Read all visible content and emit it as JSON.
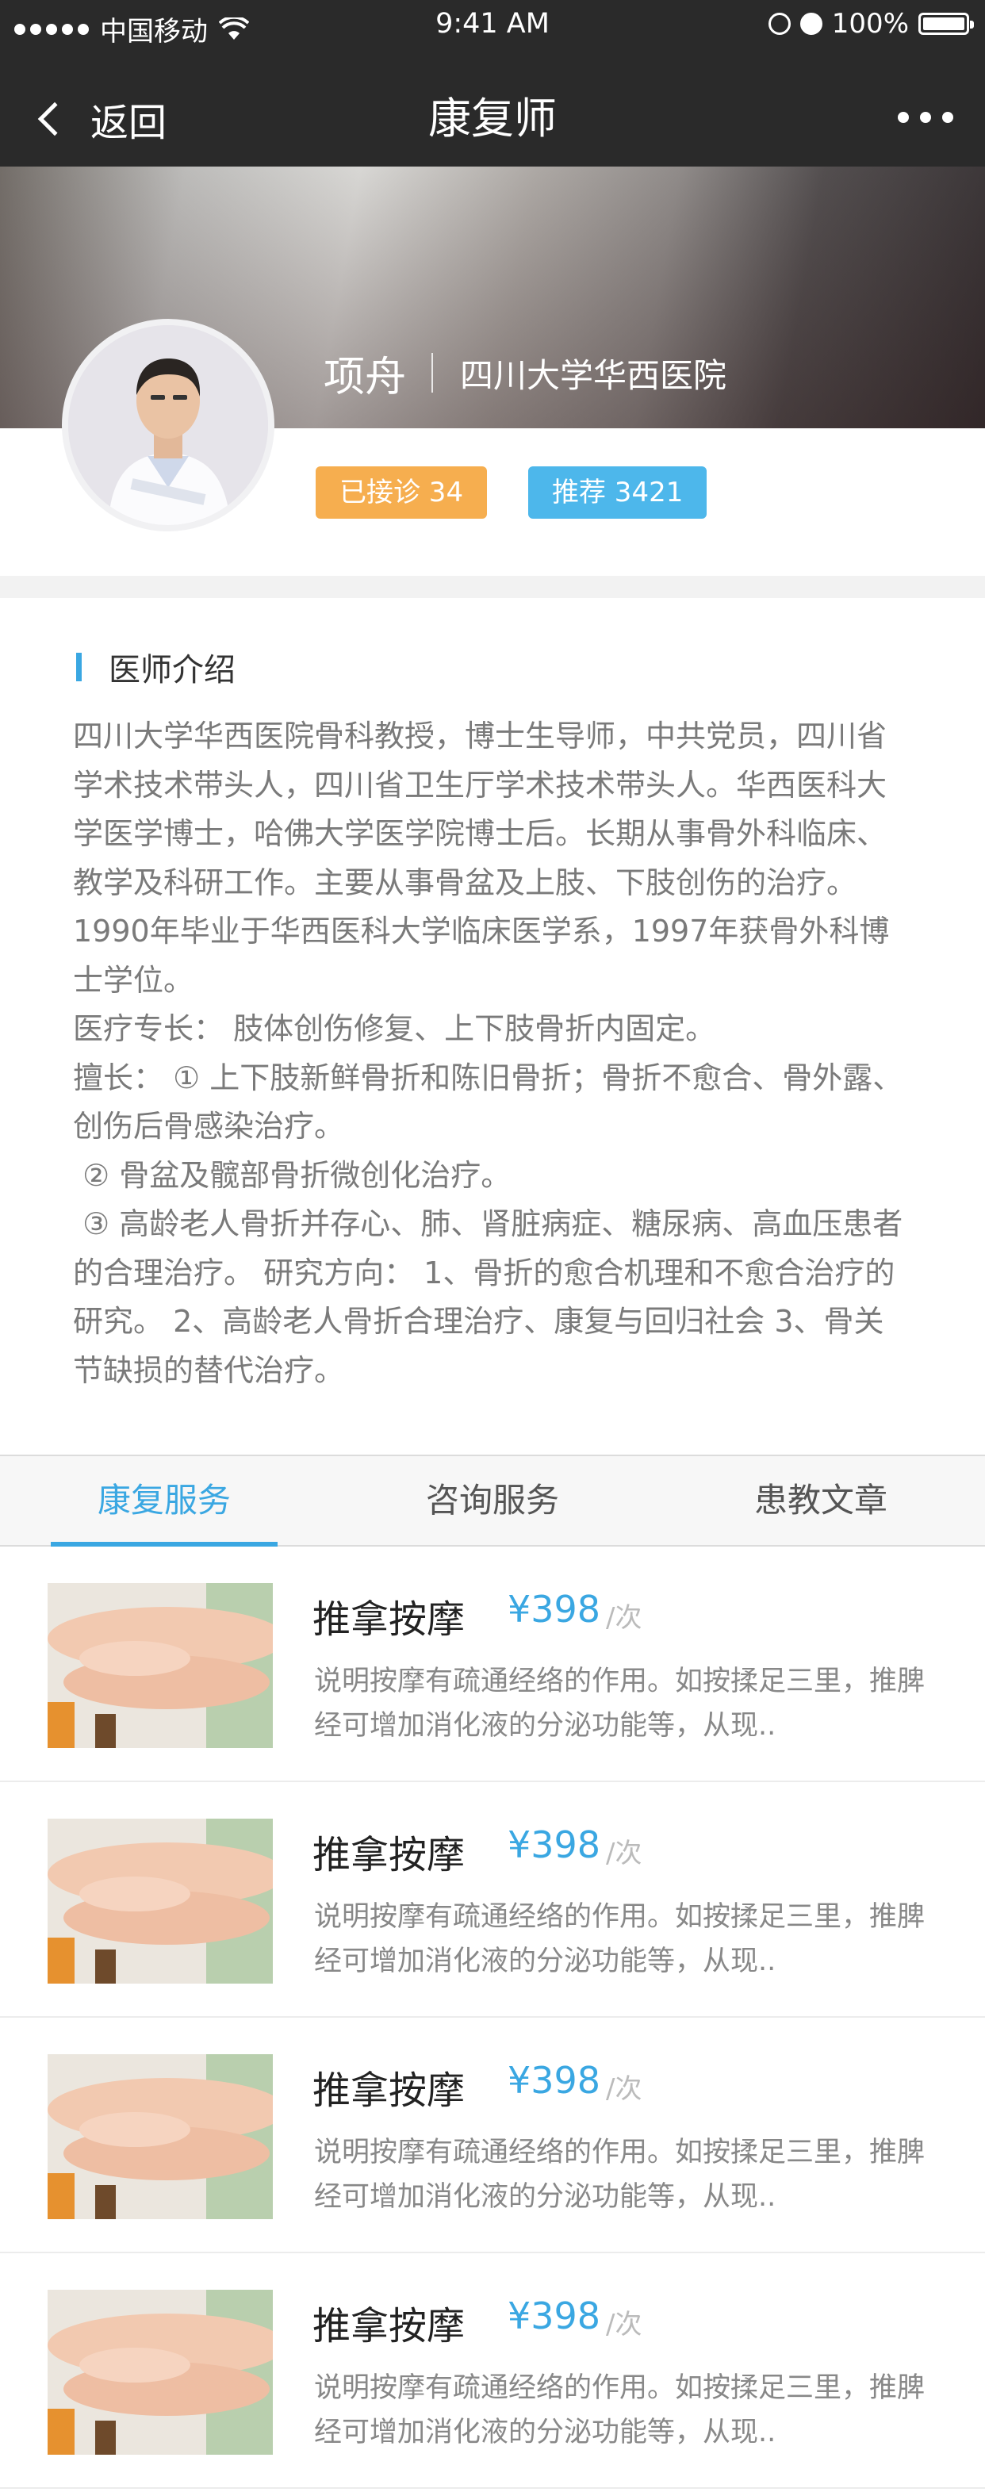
{
  "status_bar": {
    "carrier": "中国移动",
    "time": "9:41 AM",
    "battery": "100%"
  },
  "nav": {
    "back_label": "返回",
    "title": "康复师"
  },
  "doctor": {
    "name": "项舟",
    "hospital": "四川大学华西医院",
    "visited_badge": "已接诊 34",
    "recommend_badge": "推荐 3421"
  },
  "intro": {
    "title": "医师介绍",
    "text": "四川大学华西医院骨科教授，博士生导师，中共党员，四川省学术技术带头人，四川省卫生厅学术技术带头人。华西医科大学医学博士，哈佛大学医学院博士后。长期从事骨外科临床、教学及科研工作。主要从事骨盆及上肢、下肢创伤的治疗。1990年毕业于华西医科大学临床医学系，1997年获骨外科博士学位。\n医疗专长： 肢体创伤修复、上下肢骨折内固定。\n擅长： ① 上下肢新鲜骨折和陈旧骨折；骨折不愈合、骨外露、创伤后骨感染治疗。\n ② 骨盆及髋部骨折微创化治疗。\n ③ 高龄老人骨折并存心、肺、肾脏病症、糖尿病、高血压患者的合理治疗。 研究方向： 1、骨折的愈合机理和不愈合治疗的研究。 2、高龄老人骨折合理治疗、康复与回归社会 3、骨关节缺损的替代治疗。"
  },
  "tabs": [
    {
      "label": "康复服务",
      "active": true
    },
    {
      "label": "咨询服务",
      "active": false
    },
    {
      "label": "患教文章",
      "active": false
    }
  ],
  "services": [
    {
      "title": "推拿按摩",
      "price": "¥398",
      "unit": "/次",
      "desc": "说明按摩有疏通经络的作用。如按揉足三里，推脾经可增加消化液的分泌功能等，从现.."
    },
    {
      "title": "推拿按摩",
      "price": "¥398",
      "unit": "/次",
      "desc": "说明按摩有疏通经络的作用。如按揉足三里，推脾经可增加消化液的分泌功能等，从现.."
    },
    {
      "title": "推拿按摩",
      "price": "¥398",
      "unit": "/次",
      "desc": "说明按摩有疏通经络的作用。如按揉足三里，推脾经可增加消化液的分泌功能等，从现.."
    },
    {
      "title": "推拿按摩",
      "price": "¥398",
      "unit": "/次",
      "desc": "说明按摩有疏通经络的作用。如按揉足三里，推脾经可增加消化液的分泌功能等，从现.."
    }
  ],
  "colors": {
    "accent": "#3aa7e2",
    "badge_orange": "#f6ae4f",
    "badge_blue": "#4db7eb",
    "topbar": "#2a2a2a"
  }
}
